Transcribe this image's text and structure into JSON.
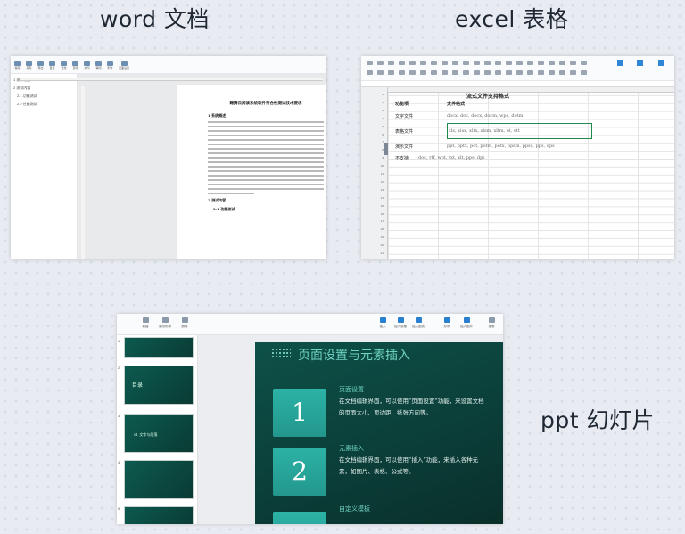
{
  "captions": {
    "word": "word 文档",
    "excel": "excel 表格",
    "ppt": "ppt 幻灯片"
  },
  "word": {
    "toolbar": [
      "保存",
      "另存",
      "导出",
      "目录",
      "查找",
      "页码",
      "水印",
      "审阅",
      "附件",
      "页面设置"
    ],
    "nav": [
      "1 测试概述",
      "2 测试内容",
      "2.1 功能测试",
      "2.2 性能测试"
    ],
    "doc_title": "翱腾云阅读系统软件符合性测试技术要求",
    "heading_1": "1 系统概述",
    "heading_2": "2 测试内容",
    "heading_3": "2.1 功能测试"
  },
  "excel": {
    "title": "流式文件支持格式",
    "header_col1": "功能项",
    "header_col2": "文件格式",
    "rows": [
      {
        "name": "文字文件",
        "formats": "docx, doc, docx, docm, wps, dotm"
      },
      {
        "name": "表格文件",
        "formats": "xls, xlsx, xltx, xlsm, xltm, et, ett"
      },
      {
        "name": "演示文件",
        "formats": "ppt, pptx, pot, potm, potx, ppsm, ppsx, pps, dps"
      },
      {
        "name": "不支持",
        "formats": "doc, rtf, wpt, txt, xlt, pps, dpt"
      }
    ]
  },
  "ppt": {
    "toolbar": [
      "新建",
      "更改布局",
      "删除",
      "插入",
      "插入表格",
      "插入图表",
      "形状",
      "插入图片",
      "插入形状",
      "搜索"
    ],
    "slide_title": "页面设置与元素插入",
    "items": [
      {
        "num": "1",
        "heading": "页面设置",
        "body": "在文档编辑界面，可以使用“页面设置”功能，来设置文档的页面大小、页边距、纸张方向等。"
      },
      {
        "num": "2",
        "heading": "元素插入",
        "body": "在文档编辑界面，可以使用“插入”功能，来插入各种元素，如图片、表格、公式等。"
      },
      {
        "num": "3",
        "heading": "自定义模板",
        "body": ""
      }
    ],
    "thumbs": [
      {
        "num": "1",
        "text": ""
      },
      {
        "num": "2",
        "text": "目录"
      },
      {
        "num": "3",
        "text": "01 文字与段落"
      },
      {
        "num": "4",
        "text": ""
      },
      {
        "num": "5",
        "text": ""
      }
    ]
  }
}
